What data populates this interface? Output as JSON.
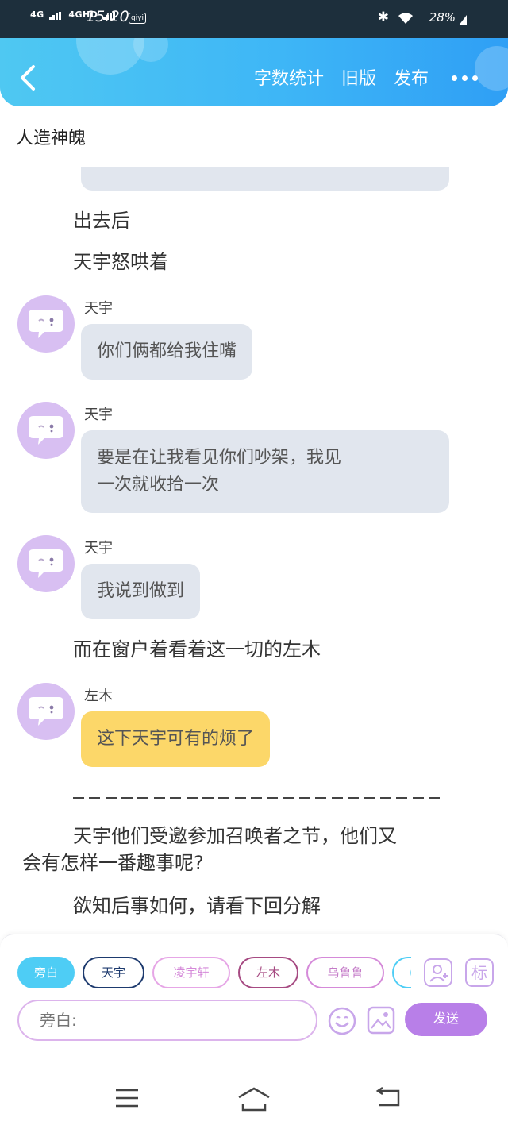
{
  "status_bar": {
    "network1": "4G",
    "network2": "4GHD",
    "time": "15:20",
    "badge": "qiyi",
    "battery": "28%"
  },
  "header": {
    "links": [
      "字数统计",
      "旧版",
      "发布"
    ]
  },
  "story_title": "人造神魄",
  "chat": {
    "narration_1": "出去后",
    "narration_2": "天宇怒哄着",
    "msg1": {
      "speaker": "天宇",
      "text": "你们俩都给我住嘴"
    },
    "msg2": {
      "speaker": "天宇",
      "line1": "要是在让我看见你们吵架，我见",
      "line2": "一次就收拾一次"
    },
    "msg3": {
      "speaker": "天宇",
      "text": "我说到做到"
    },
    "narration_3": "而在窗户着看着这一切的左木",
    "msg4": {
      "speaker": "左木",
      "text": "这下天宇可有的烦了"
    },
    "para1_line1": "天宇他们受邀参加召唤者之节，他们又",
    "para1_line2": "会有怎样一番趣事呢?",
    "para2": "欲知后事如何，请看下回分解"
  },
  "composer": {
    "tags": [
      "旁白",
      "天宇",
      "凌宇轩",
      "左木",
      "乌鲁鲁",
      "("
    ],
    "mark_label": "标",
    "input_placeholder": "旁白:",
    "send_label": "发送"
  },
  "colors": {
    "header": "#3eb6f6",
    "avatar": "#d8bff2",
    "bubble": "#e1e6ee",
    "highlight_bubble": "#fcd769",
    "send": "#b87fe8"
  }
}
